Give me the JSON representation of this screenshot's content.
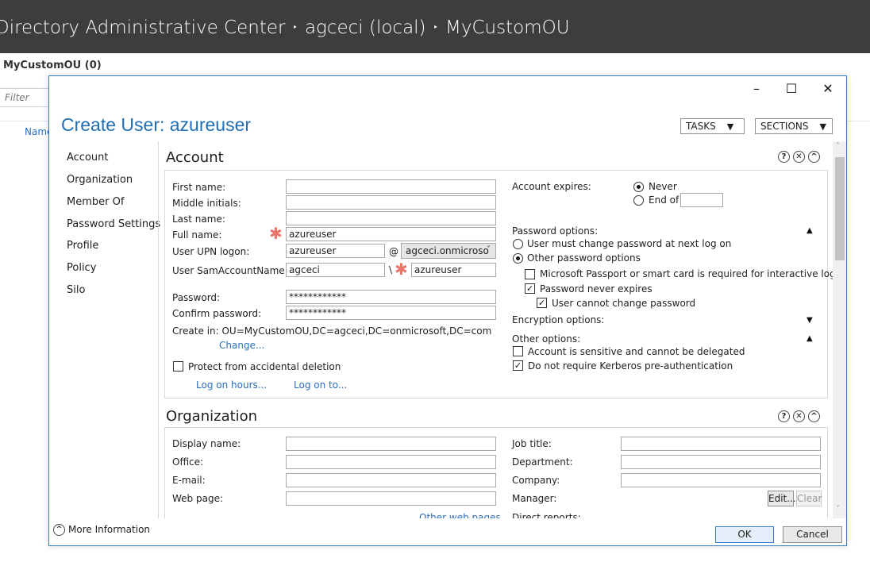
{
  "app": {
    "title_parts": [
      "Directory Administrative Center",
      "agceci (local)",
      "MyCustomOU"
    ],
    "separator": "‣",
    "ou_header": "MyCustomOU  (0)",
    "filter_placeholder": "Filter",
    "column_name": "Name"
  },
  "dialog": {
    "title": "Create User: azureuser",
    "window_buttons": {
      "minimize": "–",
      "maximize": "☐",
      "close": "✕"
    },
    "tasks_label": "TASKS",
    "sections_label": "SECTIONS",
    "arrow": "▼",
    "nav": [
      "Account",
      "Organization",
      "Member Of",
      "Password Settings",
      "Profile",
      "Policy",
      "Silo"
    ],
    "more_info": "More Information",
    "ok": "OK",
    "cancel": "Cancel"
  },
  "account": {
    "title": "Account",
    "labels": {
      "first_name": "First name:",
      "middle_initials": "Middle initials:",
      "last_name": "Last name:",
      "full_name": "Full name:",
      "upn": "User UPN logon:",
      "sam": "User SamAccountName l...",
      "password": "Password:",
      "confirm_password": "Confirm password:",
      "create_in": "Create in:  OU=MyCustomOU,DC=agceci,DC=onmicrosoft,DC=com"
    },
    "values": {
      "first_name": "",
      "middle_initials": "",
      "last_name": "",
      "full_name": "azureuser",
      "upn_user": "azureuser",
      "upn_at": "@",
      "upn_domain": "agceci.onmicroso",
      "sam_domain": "agceci",
      "sam_sep": "\\",
      "sam_user": "azureuser",
      "password": "************",
      "confirm_password": "************"
    },
    "required_mark": "✱",
    "change_link": "Change...",
    "protect_label": "Protect from accidental deletion",
    "protect_checked": false,
    "logon_hours": "Log on hours...",
    "logon_to": "Log on to...",
    "expires_label": "Account expires:",
    "expires_never": "Never",
    "expires_endof": "End of",
    "expires_selected": "Never",
    "password_options": "Password options:",
    "must_change": "User must change password at next log on",
    "other_pw": "Other password options",
    "pw_selected": "Other password options",
    "passport": "Microsoft Passport or smart card is required for interactive log on",
    "never_expires": "Password never expires",
    "cannot_change": "User cannot change password",
    "encryption": "Encryption options:",
    "other_options": "Other options:",
    "sensitive": "Account is sensitive and cannot be delegated",
    "no_kerberos": "Do not require Kerberos pre-authentication",
    "checks": {
      "passport": false,
      "never_expires": true,
      "cannot_change": true,
      "sensitive": false,
      "no_kerberos": true
    },
    "tri_up": "▲",
    "tri_down": "▼"
  },
  "organization": {
    "title": "Organization",
    "labels": {
      "display_name": "Display name:",
      "office": "Office:",
      "email": "E-mail:",
      "web_page": "Web page:",
      "job_title": "Job title:",
      "department": "Department:",
      "company": "Company:",
      "manager": "Manager:",
      "direct_reports": "Direct reports:"
    },
    "other_web_pages": "Other web pages...",
    "edit": "Edit...",
    "clear": "Clear"
  },
  "section_icons": {
    "help": "?",
    "remove": "✕",
    "collapse": "^"
  }
}
